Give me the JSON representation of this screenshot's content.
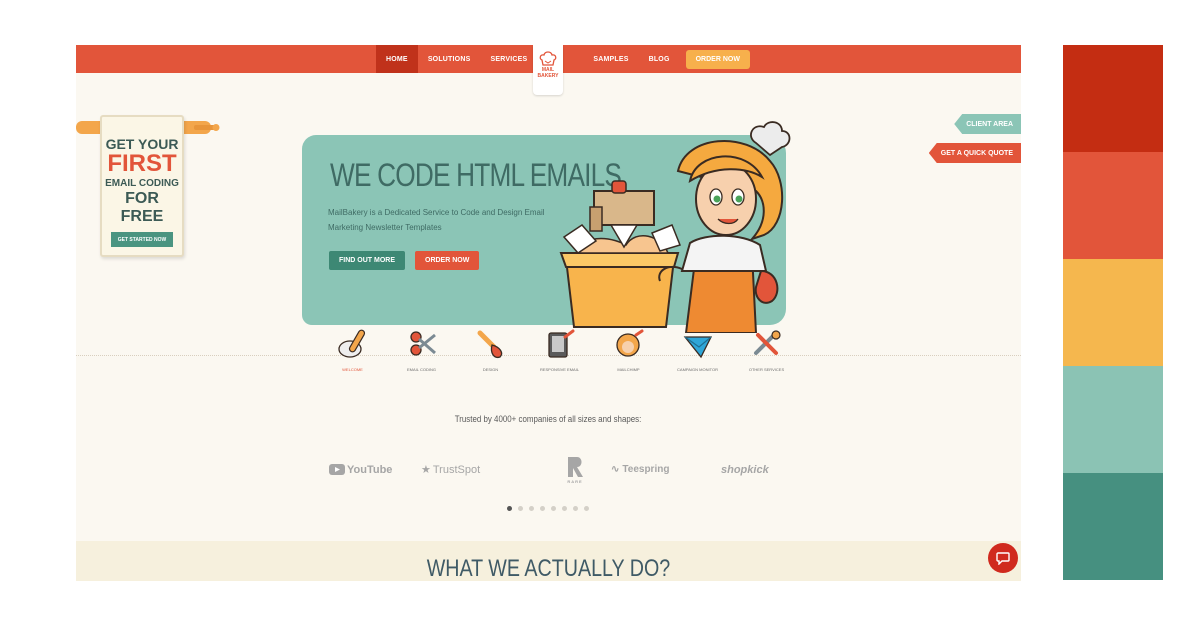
{
  "nav": {
    "items": [
      "HOME",
      "SOLUTIONS",
      "SERVICES"
    ],
    "items_right": [
      "SAMPLES",
      "BLOG"
    ],
    "cta": "ORDER NOW",
    "logo_line1": "MAIL",
    "logo_line2": "BAKERY"
  },
  "promo": {
    "line1": "GET YOUR",
    "line2": "FIRST",
    "line3": "EMAIL CODING",
    "line4": "FOR FREE",
    "button": "GET STARTED NOW"
  },
  "hero": {
    "title": "WE CODE HTML EMAILS",
    "subtitle": "MailBakery is a Dedicated Service to Code and Design Email Marketing Newsletter Templates",
    "button_primary": "FIND OUT MORE",
    "button_secondary": "ORDER NOW"
  },
  "side_tabs": {
    "client": "CLIENT AREA",
    "quote": "GET A QUICK QUOTE"
  },
  "services": [
    {
      "label": "WELCOME",
      "icon": "rolling-pin-icon"
    },
    {
      "label": "EMAIL CODING",
      "icon": "scissors-icon"
    },
    {
      "label": "DESIGN",
      "icon": "brush-icon"
    },
    {
      "label": "RESPONSIVE EMAIL",
      "icon": "devices-icon"
    },
    {
      "label": "MAILCHIMP",
      "icon": "chimp-icon"
    },
    {
      "label": "CAMPAIGN MONITOR",
      "icon": "campaign-monitor-icon"
    },
    {
      "label": "OTHER SERVICES",
      "icon": "tools-icon"
    }
  ],
  "trusted": {
    "text": "Trusted by 4000+ companies of all sizes and shapes:",
    "brands": [
      "YouTube",
      "TrustSpot",
      "RARE",
      "Teespring",
      "shopkick"
    ]
  },
  "section": {
    "title": "WHAT WE ACTUALLY DO?"
  },
  "palette": [
    "#c42d12",
    "#e2553a",
    "#f5b74e",
    "#8bc3b4",
    "#469080"
  ]
}
